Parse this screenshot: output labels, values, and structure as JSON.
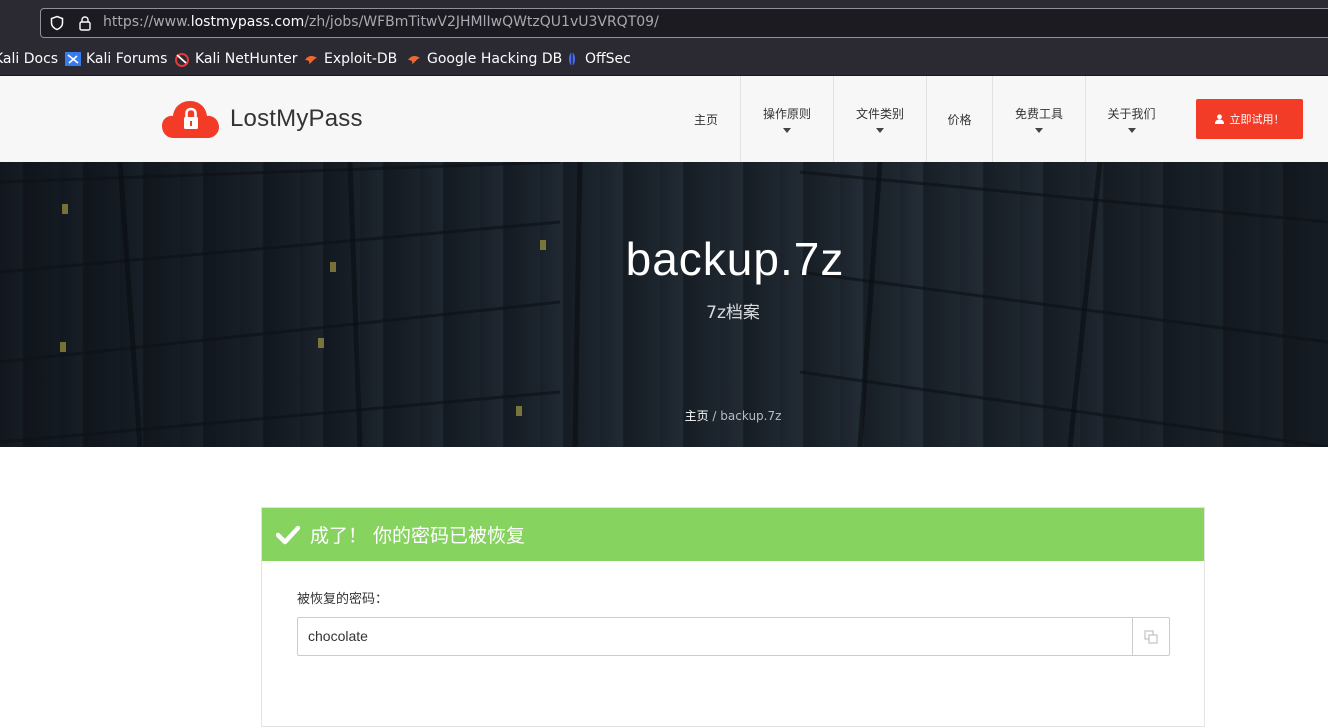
{
  "browser": {
    "url_prefix": "https://www.",
    "url_domain": "lostmypass.com",
    "url_path": "/zh/jobs/WFBmTitwV2JHMlIwQWtzQU1vU3VRQT09/",
    "bookmarks": [
      {
        "label": "Kali Docs",
        "icon": "kali-docs-icon"
      },
      {
        "label": "Kali Forums",
        "icon": "kali-forums-icon"
      },
      {
        "label": "Kali NetHunter",
        "icon": "kali-nethunter-icon"
      },
      {
        "label": "Exploit-DB",
        "icon": "exploit-db-icon"
      },
      {
        "label": "Google Hacking DB",
        "icon": "google-hacking-db-icon"
      },
      {
        "label": "OffSec",
        "icon": "offsec-icon"
      }
    ]
  },
  "header": {
    "logo_text": "LostMyPass",
    "nav": [
      {
        "label": "主页",
        "has_dropdown": false
      },
      {
        "label": "操作原则",
        "has_dropdown": true
      },
      {
        "label": "文件类别",
        "has_dropdown": true
      },
      {
        "label": "价格",
        "has_dropdown": false
      },
      {
        "label": "免费工具",
        "has_dropdown": true
      },
      {
        "label": "关于我们",
        "has_dropdown": true
      }
    ],
    "cta_label": "立即试用！",
    "brand_color": "#f23c27"
  },
  "hero": {
    "title": "backup.7z",
    "subtitle": "7z档案",
    "breadcrumb_home": "主页",
    "breadcrumb_sep": "/",
    "breadcrumb_current": "backup.7z"
  },
  "result": {
    "banner_text": "成了！ 你的密码已被恢复",
    "banner_color": "#86d35f",
    "field_label": "被恢复的密码：",
    "password": "chocolate"
  }
}
